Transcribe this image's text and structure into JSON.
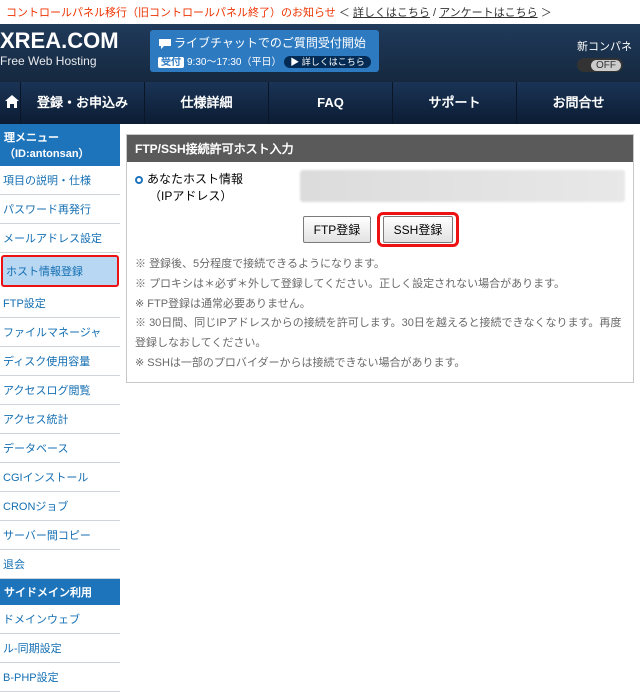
{
  "notice": {
    "red_text": "コントロールパネル移行（旧コントロールパネル終了）のお知らせ",
    "prefix": " ＜ ",
    "link1": "詳しくはこちら",
    "sep": " / ",
    "link2": "アンケートはこちら",
    "suffix": " ＞"
  },
  "brand": {
    "domain": "XREA.COM",
    "tagline": "Free Web Hosting"
  },
  "chat": {
    "main": "ライブチャットでのご質問受付開始",
    "badge": "受付",
    "hours": "9:30～17:30（平日）",
    "more": "▶ 詳しくはこちら"
  },
  "right": {
    "label": "新コンパネ",
    "toggle": "OFF"
  },
  "nav": {
    "items": [
      "登録・お申込み",
      "仕様詳細",
      "FAQ",
      "サポート",
      "お問合せ"
    ]
  },
  "sidebar": {
    "title1": "理メニュー（ID:antonsan）",
    "items1": [
      "項目の説明・仕様",
      "パスワード再発行",
      "メールアドレス設定",
      "ホスト情報登録",
      "FTP設定",
      "ファイルマネージャ",
      "ディスク使用容量",
      "アクセスログ閲覧",
      "アクセス統計",
      "データベース",
      "CGIインストール",
      "CRONジョブ",
      "サーバー間コピー",
      "退会"
    ],
    "hl_index": 3,
    "title2": "サイドメイン利用",
    "items2": [
      "ドメインウェブ",
      "ル-同期設定",
      "B-PHP設定"
    ]
  },
  "panel": {
    "heading": "FTP/SSH接続許可ホスト入力",
    "host_label": "あなたホスト情報",
    "ip_label": "（IPアドレス）",
    "btn_ftp": "FTP登録",
    "btn_ssh": "SSH登録",
    "notes": [
      "登録後、5分程度で接続できるようになります。",
      "プロキシは＊必ず＊外して登録してください。正しく設定されない場合があります。",
      "FTP登録は通常必要ありません。",
      "30日間、同じIPアドレスからの接続を許可します。30日を越えると接続できなくなります。再度登録しなおしてください。",
      "SSHは一部のプロバイダーからは接続できない場合があります。"
    ]
  }
}
